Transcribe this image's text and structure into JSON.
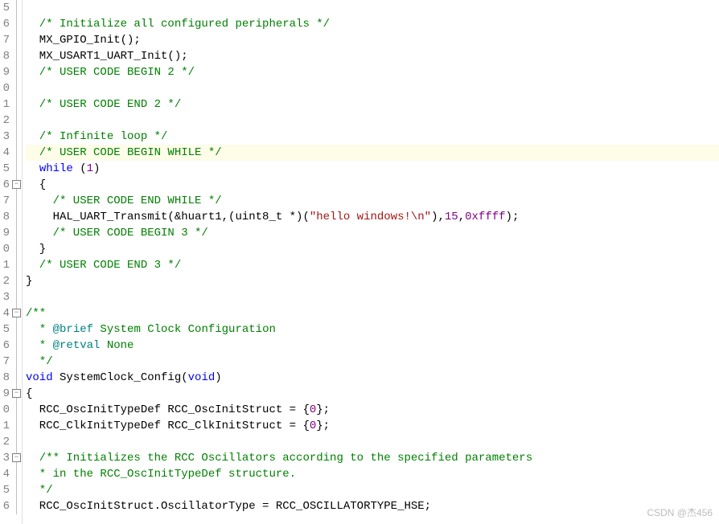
{
  "gutter": {
    "start_digits": [
      "5",
      "6",
      "7",
      "8",
      "9",
      "0",
      "1",
      "2",
      "3",
      "4",
      "5",
      "6",
      "7",
      "8",
      "9",
      "0",
      "1",
      "2",
      "3",
      "4",
      "5",
      "6",
      "7",
      "8",
      "9",
      "0",
      "1",
      "2",
      "3",
      "4",
      "5",
      "6"
    ]
  },
  "fold": {
    "boxes": [
      {
        "row": 11,
        "glyph": "−"
      },
      {
        "row": 19,
        "glyph": "−"
      },
      {
        "row": 24,
        "glyph": "−"
      },
      {
        "row": 28,
        "glyph": "−"
      }
    ]
  },
  "highlight_row": 9,
  "code": {
    "lines": [
      [],
      [
        {
          "c": "tok-comment",
          "t": "  /* Initialize all configured peripherals */"
        }
      ],
      [
        {
          "c": "",
          "t": "  MX_GPIO_Init();"
        }
      ],
      [
        {
          "c": "",
          "t": "  MX_USART1_UART_Init();"
        }
      ],
      [
        {
          "c": "tok-comment",
          "t": "  /* USER CODE BEGIN 2 */"
        }
      ],
      [],
      [
        {
          "c": "tok-comment",
          "t": "  /* USER CODE END 2 */"
        }
      ],
      [],
      [
        {
          "c": "tok-comment",
          "t": "  /* Infinite loop */"
        }
      ],
      [
        {
          "c": "tok-comment",
          "t": "  /* USER CODE BEGIN WHILE */"
        }
      ],
      [
        {
          "c": "",
          "t": "  "
        },
        {
          "c": "tok-keyword",
          "t": "while"
        },
        {
          "c": "",
          "t": " ("
        },
        {
          "c": "tok-number",
          "t": "1"
        },
        {
          "c": "",
          "t": ")"
        }
      ],
      [
        {
          "c": "",
          "t": "  {"
        }
      ],
      [
        {
          "c": "tok-comment",
          "t": "    /* USER CODE END WHILE */"
        }
      ],
      [
        {
          "c": "",
          "t": "    HAL_UART_Transmit(&huart1,(uint8_t *)("
        },
        {
          "c": "tok-string",
          "t": "\"hello windows!\\n\""
        },
        {
          "c": "",
          "t": "),"
        },
        {
          "c": "tok-number",
          "t": "15"
        },
        {
          "c": "",
          "t": ","
        },
        {
          "c": "tok-number",
          "t": "0xffff"
        },
        {
          "c": "",
          "t": ");"
        }
      ],
      [
        {
          "c": "tok-comment",
          "t": "    /* USER CODE BEGIN 3 */"
        }
      ],
      [
        {
          "c": "",
          "t": "  }"
        }
      ],
      [
        {
          "c": "tok-comment",
          "t": "  /* USER CODE END 3 */"
        }
      ],
      [
        {
          "c": "",
          "t": "}"
        }
      ],
      [],
      [
        {
          "c": "tok-comment",
          "t": "/**"
        }
      ],
      [
        {
          "c": "tok-comment",
          "t": "  * "
        },
        {
          "c": "tok-doctag",
          "t": "@brief"
        },
        {
          "c": "tok-comment",
          "t": " System Clock Configuration"
        }
      ],
      [
        {
          "c": "tok-comment",
          "t": "  * "
        },
        {
          "c": "tok-doctag",
          "t": "@retval"
        },
        {
          "c": "tok-comment",
          "t": " None"
        }
      ],
      [
        {
          "c": "tok-comment",
          "t": "  */"
        }
      ],
      [
        {
          "c": "tok-keyword",
          "t": "void"
        },
        {
          "c": "",
          "t": " SystemClock_Config("
        },
        {
          "c": "tok-keyword",
          "t": "void"
        },
        {
          "c": "",
          "t": ")"
        }
      ],
      [
        {
          "c": "",
          "t": "{"
        }
      ],
      [
        {
          "c": "",
          "t": "  RCC_OscInitTypeDef RCC_OscInitStruct = {"
        },
        {
          "c": "tok-number",
          "t": "0"
        },
        {
          "c": "",
          "t": "};"
        }
      ],
      [
        {
          "c": "",
          "t": "  RCC_ClkInitTypeDef RCC_ClkInitStruct = {"
        },
        {
          "c": "tok-number",
          "t": "0"
        },
        {
          "c": "",
          "t": "};"
        }
      ],
      [],
      [
        {
          "c": "tok-comment",
          "t": "  /** Initializes the RCC Oscillators according to the specified parameters"
        }
      ],
      [
        {
          "c": "tok-comment",
          "t": "  * in the RCC_OscInitTypeDef structure."
        }
      ],
      [
        {
          "c": "tok-comment",
          "t": "  */"
        }
      ],
      [
        {
          "c": "",
          "t": "  RCC_OscInitStruct.OscillatorType = RCC_OSCILLATORTYPE_HSE;"
        }
      ]
    ]
  },
  "watermark": "CSDN @杰456"
}
